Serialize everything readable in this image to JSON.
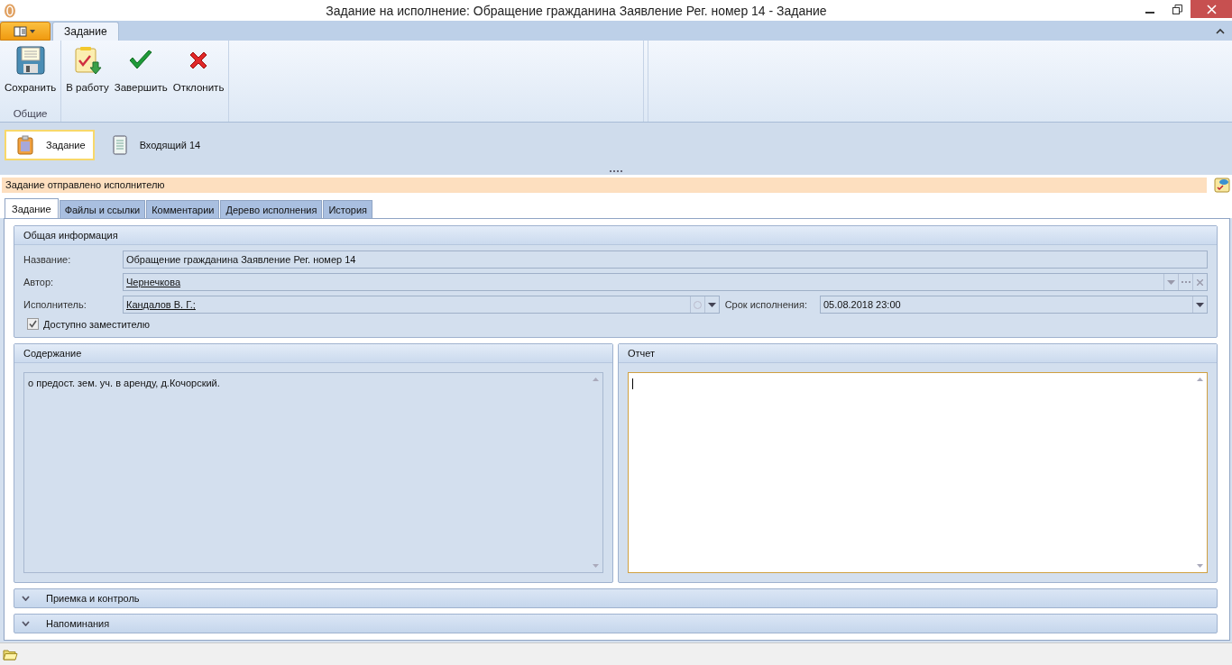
{
  "window": {
    "title": "Задание на исполнение: Обращение гражданина Заявление Рег. номер 14 - Задание"
  },
  "ribbon": {
    "tabs": [
      {
        "label": "Задание",
        "selected": true
      }
    ],
    "groups": [
      {
        "label": "Общие",
        "buttons": [
          {
            "label": "Сохранить",
            "kind": "save"
          }
        ]
      },
      {
        "buttons": [
          {
            "label": "В работу",
            "kind": "take"
          },
          {
            "label": "Завершить",
            "kind": "complete"
          },
          {
            "label": "Отклонить",
            "kind": "reject"
          }
        ]
      }
    ]
  },
  "documents": [
    {
      "label": "Задание",
      "kind": "task",
      "selected": true
    },
    {
      "label": "Входящий 14",
      "kind": "doc",
      "selected": false
    }
  ],
  "status_message": "Задание отправлено исполнителю",
  "tabs": [
    {
      "label": "Задание",
      "selected": true
    },
    {
      "label": "Файлы и ссылки",
      "selected": false
    },
    {
      "label": "Комментарии",
      "selected": false
    },
    {
      "label": "Дерево исполнения",
      "selected": false
    },
    {
      "label": "История",
      "selected": false
    }
  ],
  "general": {
    "title": "Общая информация",
    "name_label": "Название:",
    "name_value": "Обращение гражданина Заявление Рег. номер 14",
    "author_label": "Автор:",
    "author_value": "Чернечкова",
    "executor_label": "Исполнитель:",
    "executor_value": "Кандалов В. Г.;",
    "deadline_label": "Срок исполнения:",
    "deadline_value": "05.08.2018 23:00",
    "deputy": {
      "label": "Доступно заместителю",
      "checked": true
    }
  },
  "content": {
    "title": "Содержание",
    "text": "о предост. зем. уч. в аренду, д.Кочорский."
  },
  "report": {
    "title": "Отчет"
  },
  "sections": [
    {
      "title": "Приемка и контроль",
      "expanded": false
    },
    {
      "title": "Напоминания",
      "expanded": false
    }
  ]
}
